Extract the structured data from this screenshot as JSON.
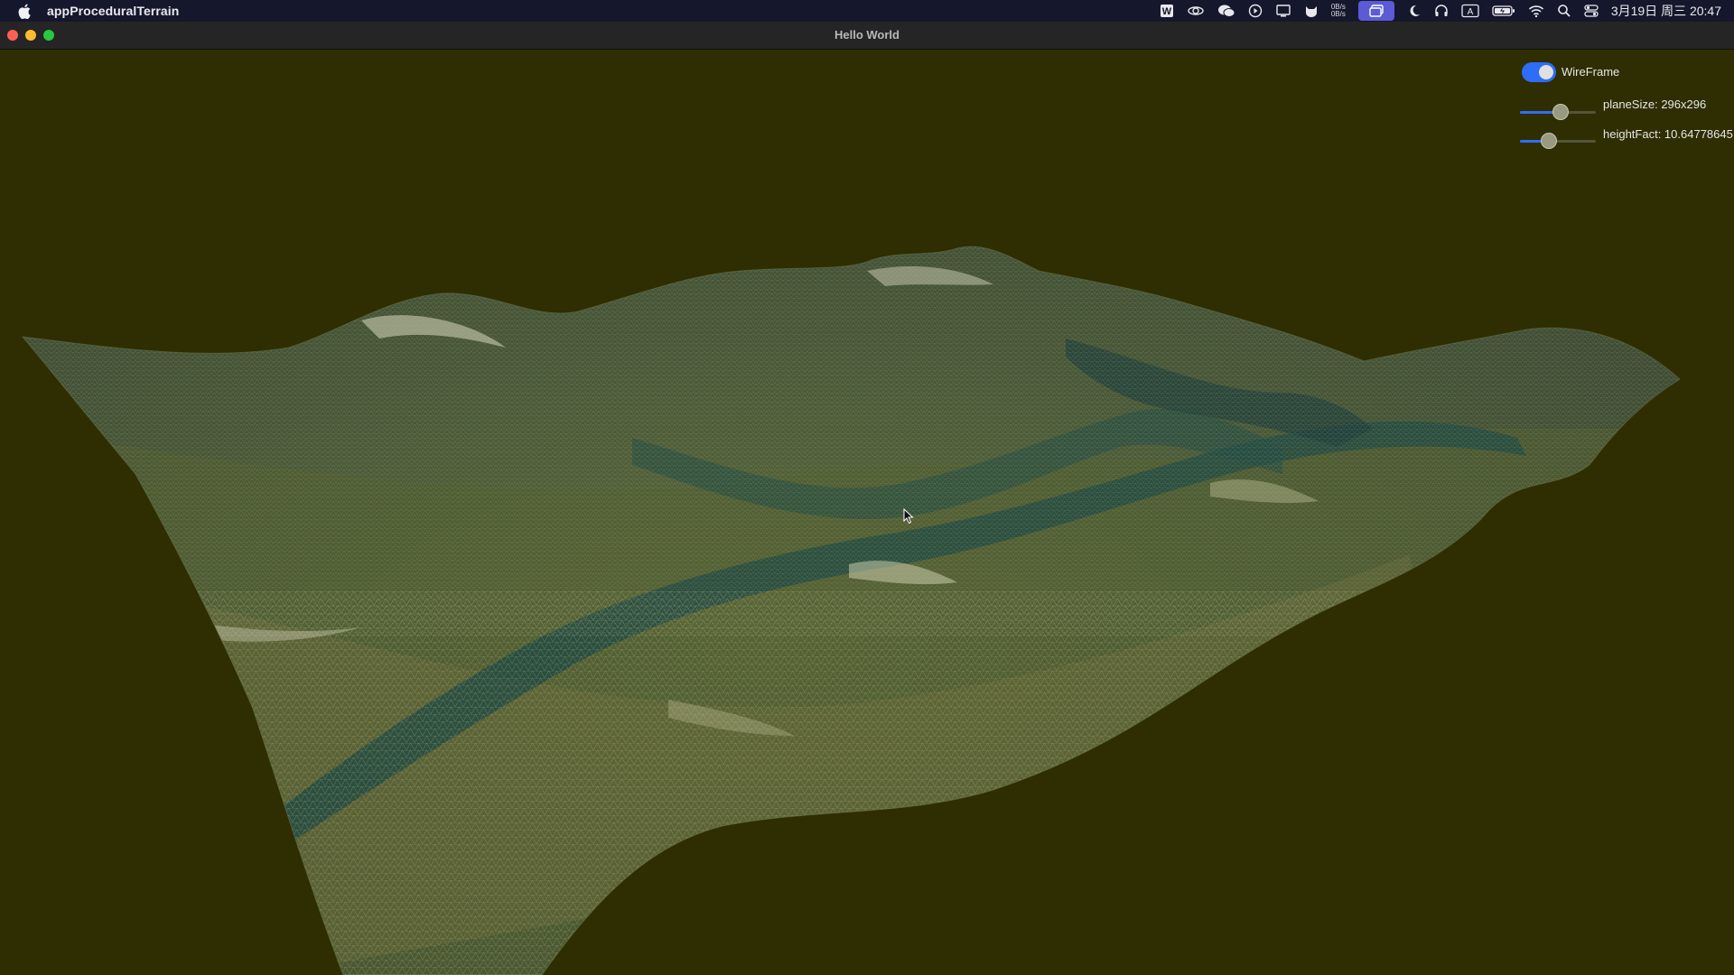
{
  "menubar": {
    "app_name": "appProceduralTerrain",
    "icons": [
      "apple-icon",
      "wps-icon",
      "sync-icon",
      "wechat-icon",
      "play-icon",
      "display-icon",
      "cat-icon",
      "network-speed-icon",
      "screens-icon",
      "moon-icon",
      "headphones-icon",
      "input-method-icon",
      "battery-icon",
      "wifi-icon",
      "search-icon",
      "control-center-icon"
    ],
    "net_up": "0B/s",
    "net_down": "0B/s",
    "input_method": "A",
    "clock": "3月19日 周三  20:47"
  },
  "window": {
    "title": "Hello World",
    "traffic_lights": {
      "close": "#ff5f57",
      "minimize": "#febc2e",
      "zoom": "#28c840"
    }
  },
  "controls": {
    "wireframe_label": "WireFrame",
    "wireframe_on": true,
    "plane_size_label": "planeSize: 296x296",
    "plane_size_fraction": 0.55,
    "height_fact_label": "heightFact: 10.64778645",
    "height_fact_fraction": 0.35
  },
  "colors": {
    "viewport_bg": "#2e2e02",
    "accent": "#2f6df6"
  }
}
